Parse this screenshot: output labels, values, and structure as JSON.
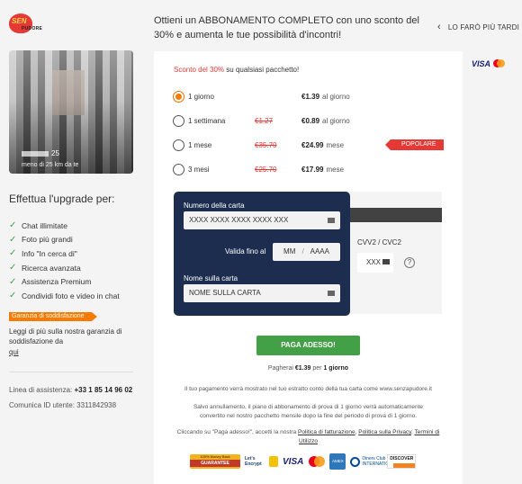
{
  "logo": {
    "line1": "SEN",
    "line2": "PUDORE"
  },
  "profile": {
    "age": "25",
    "distance": "meno di 25 km da te"
  },
  "sidebar": {
    "upgrade_title": "Effettua l'upgrade per:",
    "features": [
      "Chat illimitate",
      "Foto più grandi",
      "Info \"In cerca di\"",
      "Ricerca avanzata",
      "Assistenza Premium",
      "Condividi foto e video in chat"
    ],
    "guarantee_badge": "Garanzia di soddisfazione",
    "guarantee_text": "Leggi di più sulla nostra garanzia di soddisfazione da",
    "guarantee_link": "qui",
    "support_label": "Linea di assistenza:",
    "support_phone": "+33 1 85 14 96 02",
    "user_id": "Comunica ID utente: 3311842938"
  },
  "header": {
    "headline": "Ottieni un ABBONAMENTO COMPLETO con uno sconto del 30% e aumenta le tue possibilità d'incontri!",
    "later": "LO FARÒ PIÙ TARDI"
  },
  "offer": {
    "discount": "Sconto del 30%",
    "rest": "su qualsiasi pacchetto!"
  },
  "plans": [
    {
      "label": "1 giorno",
      "old": "",
      "price": "€1.39",
      "unit": "al giorno",
      "selected": true
    },
    {
      "label": "1 settimana",
      "old": "€1.27",
      "price": "€0.89",
      "unit": "al giorno",
      "selected": false
    },
    {
      "label": "1 mese",
      "old": "€35.70",
      "price": "€24.99",
      "unit": "mese",
      "selected": false
    },
    {
      "label": "3 mesi",
      "old": "€25.70",
      "price": "€17.99",
      "unit": "mese",
      "selected": false
    }
  ],
  "popular_tag": "POPOLARE",
  "brands_top": {
    "visa": "VISA"
  },
  "card_form": {
    "number_label": "Numero della carta",
    "number_placeholder": "XXXX XXXX XXXX XXXX XXX",
    "expiry_label": "Valida fino al",
    "expiry_mm": "MM",
    "expiry_sep": "/",
    "expiry_yy": "AAAA",
    "name_label": "Nome sulla carta",
    "name_placeholder": "NOME SULLA CARTA",
    "cvv_label": "CVV2 / CVC2",
    "cvv_placeholder": "XXX",
    "help": "?"
  },
  "pay": {
    "button": "PAGA ADESSO!",
    "note_prefix": "Pagherai",
    "note_amount": "€1.39",
    "note_mid": "per",
    "note_period": "1 giorno"
  },
  "legal": {
    "statement": "Il tuo pagamento verrà mostrato nel tuo estratto conto della tua carta come www.senzapudore.it",
    "renewal": "Salvo annullamento, il piano di abbonamento di prova di 1 giorno verrà automaticamente convertito nel nostro pacchetto mensile dopo la fine del periodo di prova di 1 giorno.",
    "terms_prefix": "Cliccando su \"Paga adesso!\", accetti la nostra",
    "billing_policy": "Politica di fatturazione",
    "privacy_policy": "Politica sulla Privacy",
    "terms": "Termini di Utilizzo"
  },
  "badges": {
    "guarantee_top": "100% Money Back",
    "guarantee": "GUARANTEE",
    "letsencrypt": "Let's Encrypt",
    "visa": "VISA",
    "amex": "AMEX",
    "diners": "Diners Club INTERNATIONAL",
    "discover": "DISCOVER"
  },
  "colors": {
    "accent": "#f57c00",
    "pay": "#43a047",
    "discount": "#e53935",
    "card": "#1c2d4f"
  }
}
